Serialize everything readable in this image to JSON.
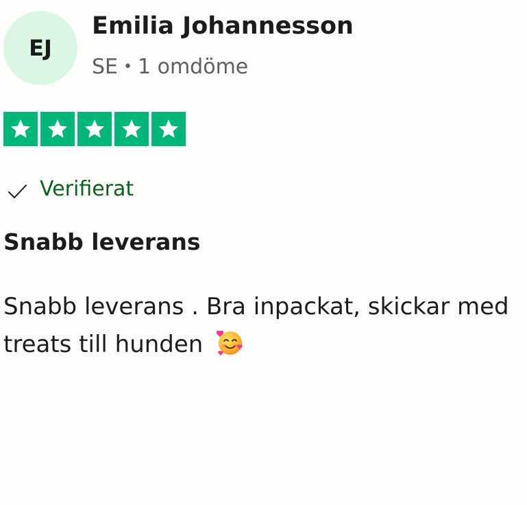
{
  "review": {
    "avatar_initials": "EJ",
    "reviewer_name": "Emilia Johannesson",
    "country": "SE",
    "separator": "•",
    "review_count": "1 omdöme",
    "rating": 5,
    "rating_max": 5,
    "star_color": "#00b67a",
    "verified_label": "Verifierat",
    "title": "Snabb leverans",
    "body": "Snabb leverans . Bra inpackat, skickar med treats till hunden",
    "body_emoji": "smiling-face-with-hearts-icon"
  }
}
